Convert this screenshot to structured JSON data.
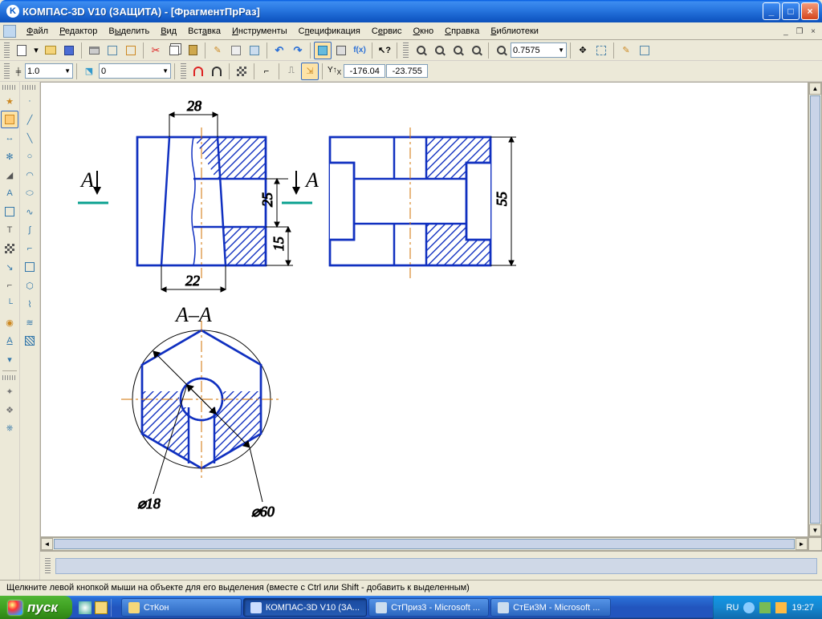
{
  "title": "КОМПАС-3D V10 (ЗАЩИТА) - [ФрагментПрРаз]",
  "menu": {
    "file": "Файл",
    "editor": "Редактор",
    "select": "Выделить",
    "view": "Вид",
    "insert": "Вставка",
    "tools": "Инструменты",
    "spec": "Спецификация",
    "service": "Сервис",
    "window": "Окно",
    "help": "Справка",
    "libs": "Библиотеки"
  },
  "toolbar": {
    "zoom_value": "0.7575",
    "style_value": "1.0",
    "layer_value": "0",
    "coord_x": "-176.04",
    "coord_y": "-23.755",
    "coord_prefix_x": "x",
    "coord_prefix_y": "y"
  },
  "drawing": {
    "dim_top": "28",
    "dim_bottom": "22",
    "dim_r_upper": "25",
    "dim_r_lower": "15",
    "dim_right": "55",
    "section_lbl_A": "А",
    "section_title": "А–А",
    "diam1": "⌀18",
    "diam2": "⌀60"
  },
  "status": "Щелкните левой кнопкой мыши на объекте для его выделения (вместе с Ctrl или Shift - добавить к выделенным)",
  "taskbar": {
    "start": "пуск",
    "btn1": "СтКон",
    "btn2": "КОМПАС-3D V10 (ЗА...",
    "btn3": "СтПриз3 - Microsoft ...",
    "btn4": "СтЕи3М - Microsoft ...",
    "lang": "RU",
    "clock": "19:27"
  }
}
